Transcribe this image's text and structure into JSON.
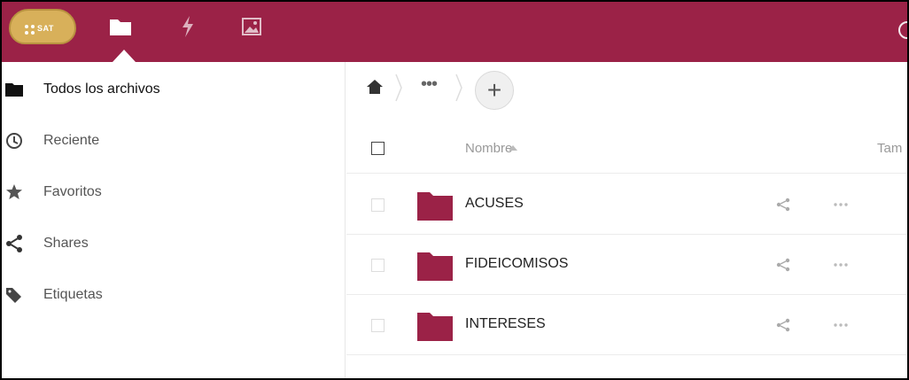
{
  "header": {
    "logo_text": "SAT",
    "colors": {
      "bar": "#9b2247",
      "logo": "#d8b05a"
    },
    "nav": [
      {
        "icon": "folder-icon"
      },
      {
        "icon": "lightning-icon"
      },
      {
        "icon": "image-icon"
      }
    ]
  },
  "sidebar": {
    "items": [
      {
        "label": "Todos los archivos",
        "icon": "folder-icon"
      },
      {
        "label": "Reciente",
        "icon": "clock-icon"
      },
      {
        "label": "Favoritos",
        "icon": "star-icon"
      },
      {
        "label": "Shares",
        "icon": "share-icon"
      },
      {
        "label": "Etiquetas",
        "icon": "tag-icon"
      }
    ]
  },
  "breadcrumb": {
    "home_icon": "home-icon",
    "more": "•••",
    "add": "+"
  },
  "table": {
    "columns": {
      "name": "Nombre",
      "size": "Tam"
    },
    "rows": [
      {
        "name": "ACUSES"
      },
      {
        "name": "FIDEICOMISOS"
      },
      {
        "name": "INTERESES"
      }
    ]
  }
}
